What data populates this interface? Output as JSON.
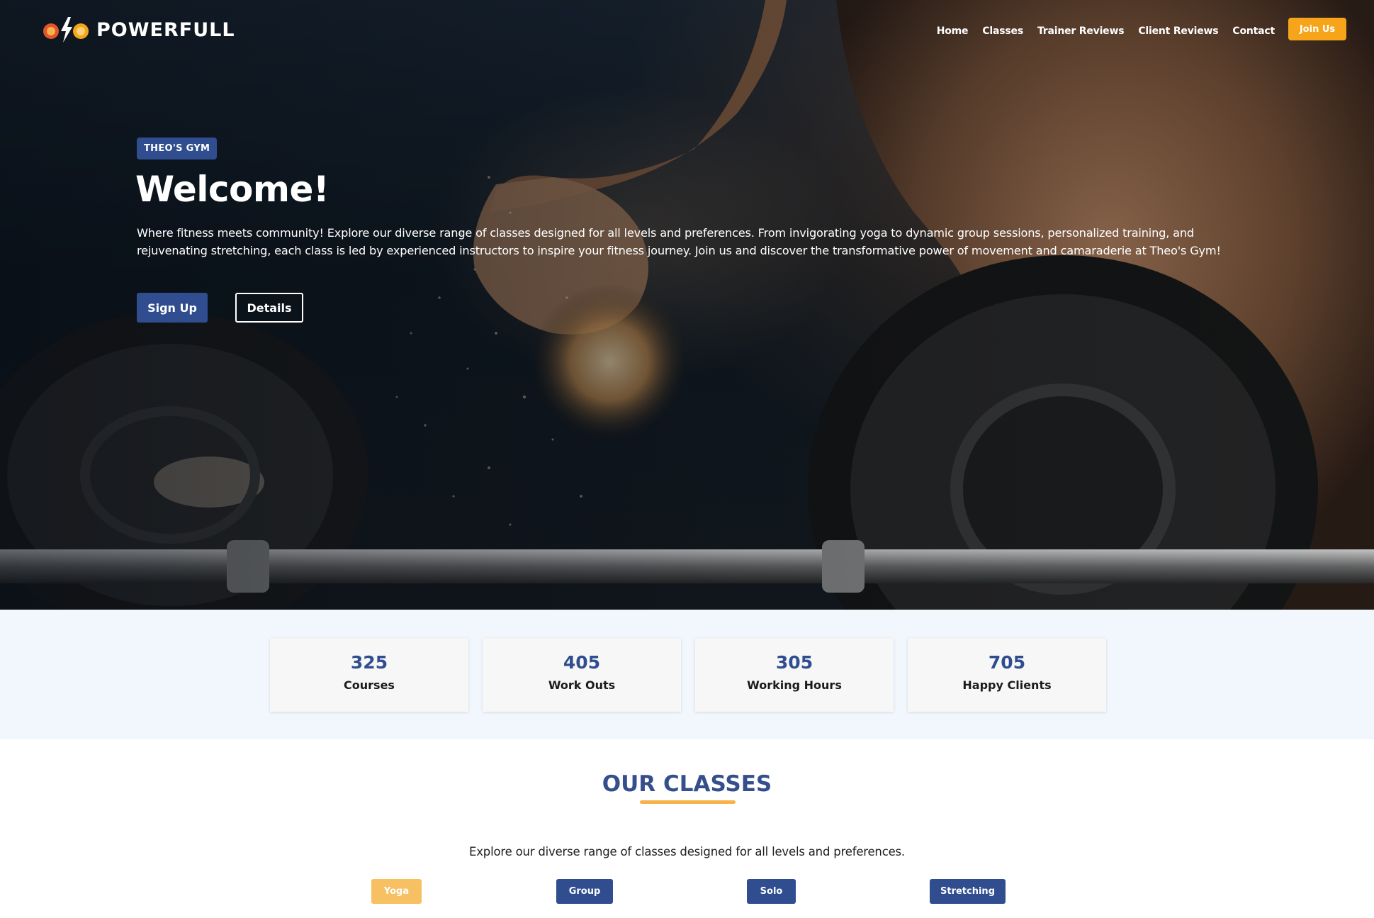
{
  "brand": {
    "name": "POWERFULL"
  },
  "nav": {
    "links": [
      "Home",
      "Classes",
      "Trainer Reviews",
      "Client Reviews",
      "Contact"
    ],
    "cta": "Join Us"
  },
  "hero": {
    "badge": "THEO'S GYM",
    "title": "Welcome!",
    "description": "Where fitness meets community! Explore our diverse range of classes designed for all levels and preferences. From invigorating yoga to dynamic group sessions, personalized training, and rejuvenating stretching, each class is led by experienced instructors to inspire your fitness journey. Join us and discover the transformative power of movement and camaraderie at Theo's Gym!",
    "primary_button": "Sign Up",
    "secondary_button": "Details"
  },
  "stats": [
    {
      "value": "325",
      "label": "Courses"
    },
    {
      "value": "405",
      "label": "Work Outs"
    },
    {
      "value": "305",
      "label": "Working Hours"
    },
    {
      "value": "705",
      "label": "Happy Clients"
    }
  ],
  "classes": {
    "title": "OUR CLASSES",
    "description": "Explore our diverse range of classes designed for all levels and preferences.",
    "filters": [
      {
        "label": "Yoga",
        "active": true
      },
      {
        "label": "Group",
        "active": false
      },
      {
        "label": "Solo",
        "active": false
      },
      {
        "label": "Stretching",
        "active": false
      }
    ]
  },
  "colors": {
    "primary": "#2f4d8f",
    "accent": "#f6a51a",
    "filter_active": "#f7c062",
    "stats_bg": "#f1f7fd"
  }
}
